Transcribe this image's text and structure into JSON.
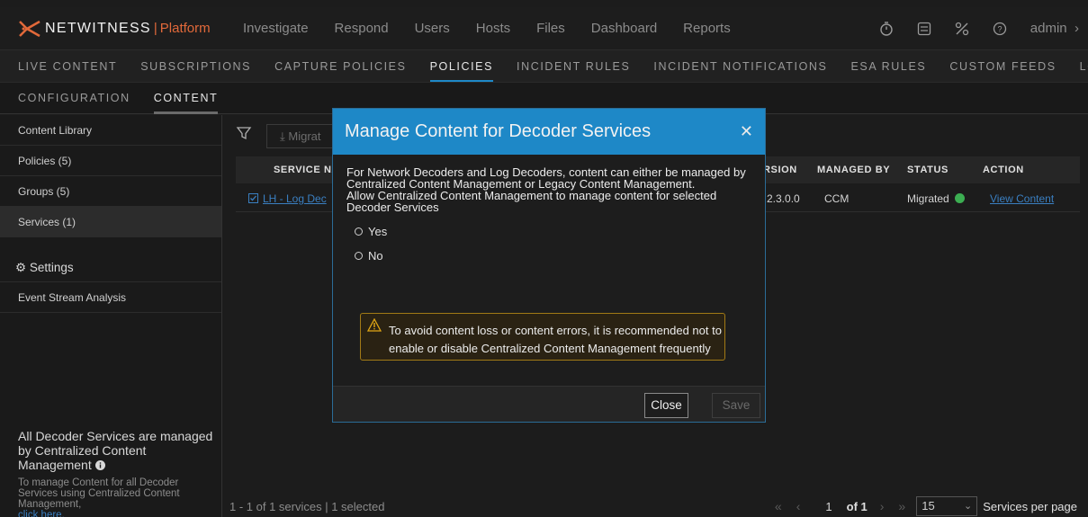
{
  "brand": {
    "name": "NETWITNESS",
    "separator": "|",
    "product": "Platform"
  },
  "main_nav": [
    "Investigate",
    "Respond",
    "Users",
    "Hosts",
    "Files",
    "Dashboard",
    "Reports"
  ],
  "user": {
    "label": "admin"
  },
  "sub_nav": {
    "items": [
      "LIVE CONTENT",
      "SUBSCRIPTIONS",
      "CAPTURE POLICIES",
      "POLICIES",
      "INCIDENT RULES",
      "INCIDENT NOTIFICATIONS",
      "ESA RULES",
      "CUSTOM FEEDS",
      "LOG PARSER R"
    ],
    "active": "POLICIES"
  },
  "third_nav": {
    "items": [
      "CONFIGURATION",
      "CONTENT"
    ],
    "active": "CONTENT"
  },
  "sidebar": {
    "items": [
      "Content Library",
      "Policies (5)",
      "Groups (5)",
      "Services (1)"
    ],
    "active": "Services (1)",
    "settings": "Settings",
    "event_stream": "Event Stream Analysis",
    "footer_title": "All Decoder Services are managed by Centralized Content Management",
    "footer_desc": "To manage Content for all Decoder Services using Centralized Content Management,",
    "footer_link": "click here."
  },
  "toolbar": {
    "migrate_label": "Migrat"
  },
  "table": {
    "headers": {
      "service_name": "SERVICE NA",
      "version": "RSION",
      "managed_by": "MANAGED BY",
      "status": "STATUS",
      "action": "ACTION"
    },
    "row": {
      "service_name": "LH - Log Dec",
      "version": "2.3.0.0",
      "managed_by": "CCM",
      "status": "Migrated",
      "action": "View Content"
    }
  },
  "footer": {
    "count": "1 - 1 of 1 services | 1 selected",
    "page": "1",
    "of": "of 1",
    "per_page": "15",
    "per_page_label": "Services per page"
  },
  "modal": {
    "title": "Manage Content for Decoder Services",
    "para1_line1": "For Network Decoders and Log Decoders, content can either be managed by",
    "para1_line2": "Centralized Content Management or Legacy Content Management.",
    "para2_line1": "Allow Centralized Content Management to manage content for selected",
    "para2_line2": "Decoder Services",
    "options": [
      "Yes",
      "No"
    ],
    "warning_line1": "To avoid content loss or content errors, it is recommended not to",
    "warning_line2": "enable or disable Centralized Content Management frequently",
    "close_label": "Close",
    "save_label": "Save"
  },
  "colors": {
    "accent": "#1e88c7",
    "brand": "#e2693a",
    "success": "#3cae52",
    "warning": "#e0a614"
  }
}
